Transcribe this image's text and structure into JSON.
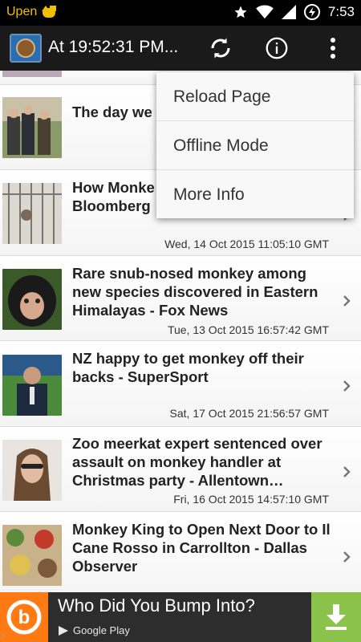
{
  "status_bar": {
    "carrier": "Upen",
    "time": "7:53",
    "icons": [
      "cat-notification-icon",
      "star-icon",
      "wifi-icon",
      "signal-icon",
      "battery-icon"
    ]
  },
  "app_bar": {
    "title": "At 19:52:31 PM...",
    "actions": [
      "refresh-icon",
      "info-icon",
      "overflow-menu-icon"
    ]
  },
  "menu": {
    "items": [
      "Reload Page",
      "Offline Mode",
      "More Info"
    ]
  },
  "articles": [
    {
      "title": "The day we drive a car o (subscriptio",
      "date": ""
    },
    {
      "title": "How Monke Business in Florida - Bloomberg",
      "date": "Wed, 14 Oct 2015 11:05:10 GMT"
    },
    {
      "title": "Rare snub-nosed monkey among new species discovered in Eastern Himalayas - Fox News",
      "date": "Tue, 13 Oct 2015 16:57:42 GMT"
    },
    {
      "title": "NZ happy to get monkey off their backs - SuperSport",
      "date": "Sat, 17 Oct 2015 21:56:57 GMT"
    },
    {
      "title": "Zoo meerkat expert sentenced over assault on monkey handler at Christmas party - Allentown…",
      "date": "Fri, 16 Oct 2015 14:57:10 GMT"
    },
    {
      "title": "Monkey King to Open Next Door to Il Cane Rosso in Carrollton - Dallas Observer",
      "date": ""
    }
  ],
  "ad": {
    "title": "Who Did You Bump Into?",
    "store": "Google Play",
    "logo_letter": "b",
    "badge": "▷"
  },
  "colors": {
    "status_bar": "#000000",
    "app_bar": "#1a1a1a",
    "carrier_text": "#f0c000",
    "ad_logo": "#ff7a12",
    "ad_download": "#8bc34a"
  }
}
